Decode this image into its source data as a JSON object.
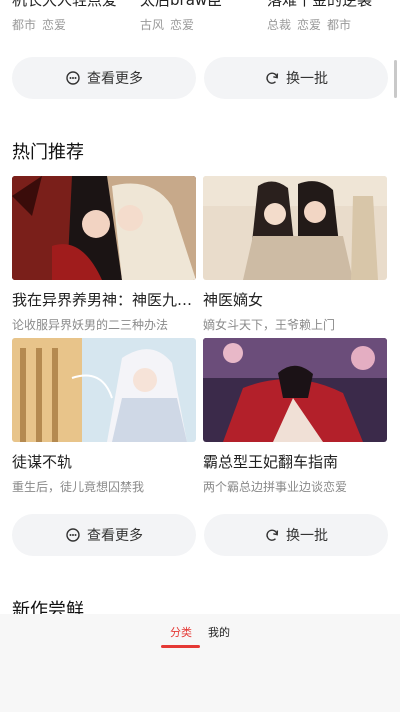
{
  "top_row": [
    {
      "title": "机长大人轻点爱",
      "tags": [
        "都市",
        "恋爱"
      ]
    },
    {
      "title": "太后braw臣",
      "tags": [
        "古风",
        "恋爱"
      ]
    },
    {
      "title": "落难千金的逆袭",
      "tags": [
        "总裁",
        "恋爱",
        "都市"
      ]
    }
  ],
  "actions1": {
    "more": "查看更多",
    "refresh": "换一批"
  },
  "hot": {
    "title": "热门推荐",
    "items": [
      {
        "title": "我在异界养男神：神医九…",
        "desc": "论收服异界妖男的二三种办法"
      },
      {
        "title": "神医嫡女",
        "desc": "嫡女斗天下，王爷赖上门"
      },
      {
        "title": "徒谋不轨",
        "desc": "重生后，徒儿竟想囚禁我"
      },
      {
        "title": "霸总型王妃翻车指南",
        "desc": "两个霸总边拼事业边谈恋爱"
      }
    ]
  },
  "actions2": {
    "more": "查看更多",
    "refresh": "换一批"
  },
  "new_section": {
    "title": "新作尝鲜"
  },
  "bottom_tabs": {
    "category": "分类",
    "mine": "我的"
  },
  "colors": {
    "accent": "#e53935",
    "pill_bg": "#f3f4f6",
    "muted": "#999999"
  }
}
